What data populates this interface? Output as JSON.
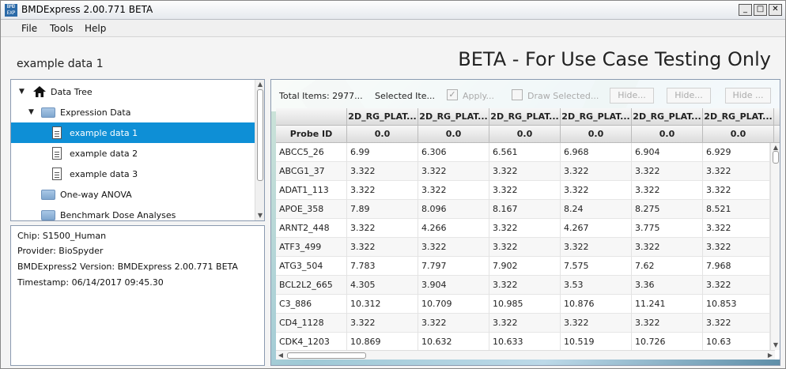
{
  "window": {
    "title": "BMDExpress 2.00.771 BETA",
    "icon_text": "BMD EXP",
    "controls": [
      "_",
      "□",
      "✕"
    ]
  },
  "menu": [
    "File",
    "Tools",
    "Help"
  ],
  "header": {
    "dataset_title": "example data 1",
    "banner": "BETA - For Use Case Testing Only"
  },
  "tree": {
    "items": [
      {
        "label": "Data Tree",
        "level": 0,
        "icon": "home-icon",
        "expanded": true
      },
      {
        "label": "Expression Data",
        "level": 1,
        "icon": "folder-icon",
        "expanded": true
      },
      {
        "label": "example data 1",
        "level": 2,
        "icon": "document-icon",
        "selected": true
      },
      {
        "label": "example data 2",
        "level": 2,
        "icon": "document-icon"
      },
      {
        "label": "example data 3",
        "level": 2,
        "icon": "document-icon"
      },
      {
        "label": "One-way ANOVA",
        "level": 1,
        "icon": "folder-icon"
      },
      {
        "label": "Benchmark Dose Analyses",
        "level": 1,
        "icon": "folder-icon"
      }
    ]
  },
  "info": {
    "chip": "Chip: S1500_Human",
    "provider": "Provider: BioSpyder",
    "version": "BMDExpress2 Version: BMDExpress 2.00.771 BETA",
    "timestamp": "Timestamp: 06/14/2017 09:45.30"
  },
  "toolbar": {
    "total_items": "Total Items: 2977...",
    "selected_items": "Selected Ite...",
    "apply_label": "Apply...",
    "draw_selected_label": "Draw Selected...",
    "hide_buttons": [
      "Hide...",
      "Hide...",
      "Hide ..."
    ]
  },
  "table": {
    "probe_header": "Probe ID",
    "columns": [
      "2D_RG_PLAT...",
      "2D_RG_PLAT...",
      "2D_RG_PLAT...",
      "2D_RG_PLAT...",
      "2D_RG_PLAT...",
      "2D_RG_PLAT..."
    ],
    "doses": [
      "0.0",
      "0.0",
      "0.0",
      "0.0",
      "0.0",
      "0.0"
    ],
    "rows": [
      [
        "ABCC5_26",
        "6.99",
        "6.306",
        "6.561",
        "6.968",
        "6.904",
        "6.929"
      ],
      [
        "ABCG1_37",
        "3.322",
        "3.322",
        "3.322",
        "3.322",
        "3.322",
        "3.322"
      ],
      [
        "ADAT1_113",
        "3.322",
        "3.322",
        "3.322",
        "3.322",
        "3.322",
        "3.322"
      ],
      [
        "APOE_358",
        "7.89",
        "8.096",
        "8.167",
        "8.24",
        "8.275",
        "8.521"
      ],
      [
        "ARNT2_448",
        "3.322",
        "4.266",
        "3.322",
        "4.267",
        "3.775",
        "3.322"
      ],
      [
        "ATF3_499",
        "3.322",
        "3.322",
        "3.322",
        "3.322",
        "3.322",
        "3.322"
      ],
      [
        "ATG3_504",
        "7.783",
        "7.797",
        "7.902",
        "7.575",
        "7.62",
        "7.968"
      ],
      [
        "BCL2L2_665",
        "4.305",
        "3.904",
        "3.322",
        "3.53",
        "3.36",
        "3.322"
      ],
      [
        "C3_886",
        "10.312",
        "10.709",
        "10.985",
        "10.876",
        "11.241",
        "10.853"
      ],
      [
        "CD4_1128",
        "3.322",
        "3.322",
        "3.322",
        "3.322",
        "3.322",
        "3.322"
      ],
      [
        "CDK4_1203",
        "10.869",
        "10.632",
        "10.633",
        "10.519",
        "10.726",
        "10.63"
      ]
    ]
  }
}
